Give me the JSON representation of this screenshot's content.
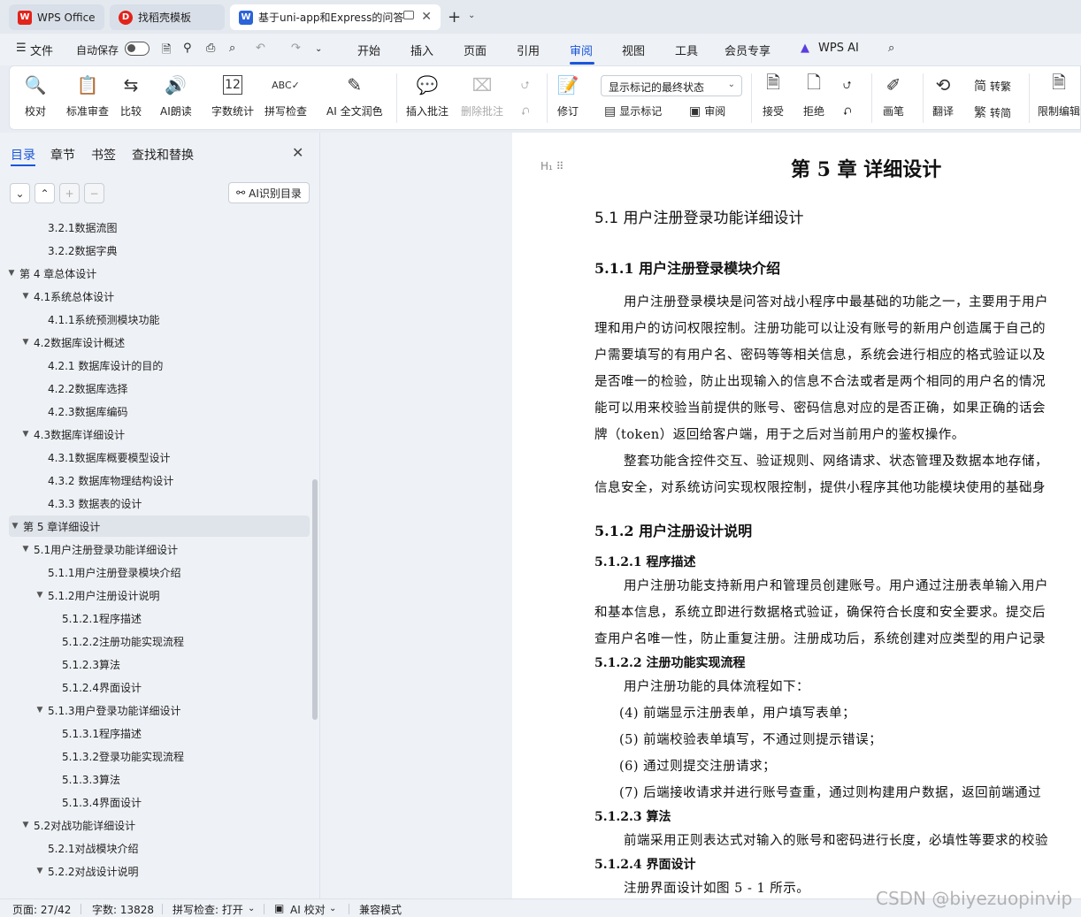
{
  "tabs": [
    {
      "label": "WPS Office",
      "icon": "wps-logo-icon"
    },
    {
      "label": "找稻壳模板",
      "icon": "docer-icon"
    },
    {
      "label": "基于uni-app和Express的问答",
      "icon": "word-doc-icon",
      "active": true
    }
  ],
  "menubar": {
    "file": "文件",
    "autosave": "自动保存",
    "items": [
      "开始",
      "插入",
      "页面",
      "引用",
      "审阅",
      "视图",
      "工具",
      "会员专享",
      "WPS AI"
    ],
    "active": "审阅"
  },
  "ribbon": {
    "proofread": "校对",
    "standard_review": "标准审查",
    "compare": "比较",
    "ai_read": "AI朗读",
    "word_count": "字数统计",
    "spell_check": "拼写检查",
    "ai_proof": "AI 全文润色",
    "insert_comment": "插入批注",
    "delete_comment": "删除批注",
    "track_changes": "修订",
    "display_select": "显示标记的最终状态",
    "show_markup": "显示标记",
    "review_pane": "审阅",
    "accept": "接受",
    "reject": "拒绝",
    "pen": "画笔",
    "translate": "翻译",
    "to_traditional": "转繁",
    "to_simplified": "转简",
    "restrict_edit": "限制编辑"
  },
  "nav": {
    "tabs": [
      "目录",
      "章节",
      "书签",
      "查找和替换"
    ],
    "ai_toc": "AI识别目录",
    "toc": [
      {
        "text": "3.2.1数据流图",
        "level": 3,
        "arrow": ""
      },
      {
        "text": "3.2.2数据字典",
        "level": 3,
        "arrow": ""
      },
      {
        "text": "第 4 章总体设计",
        "level": 1,
        "arrow": "▼"
      },
      {
        "text": "4.1系统总体设计",
        "level": 2,
        "arrow": "▼"
      },
      {
        "text": "4.1.1系统预测模块功能",
        "level": 3,
        "arrow": ""
      },
      {
        "text": "4.2数据库设计概述",
        "level": 2,
        "arrow": "▼"
      },
      {
        "text": "4.2.1  数据库设计的目的",
        "level": 3,
        "arrow": ""
      },
      {
        "text": "4.2.2数据库选择",
        "level": 3,
        "arrow": ""
      },
      {
        "text": "4.2.3数据库编码",
        "level": 3,
        "arrow": ""
      },
      {
        "text": "4.3数据库详细设计",
        "level": 2,
        "arrow": "▼"
      },
      {
        "text": "4.3.1数据库概要模型设计",
        "level": 3,
        "arrow": ""
      },
      {
        "text": "4.3.2  数据库物理结构设计",
        "level": 3,
        "arrow": ""
      },
      {
        "text": "4.3.3     数据表的设计",
        "level": 3,
        "arrow": ""
      },
      {
        "text": "第 5 章详细设计",
        "level": 1,
        "arrow": "▼",
        "selected": true
      },
      {
        "text": "5.1用户注册登录功能详细设计",
        "level": 2,
        "arrow": "▼"
      },
      {
        "text": "5.1.1用户注册登录模块介绍",
        "level": 3,
        "arrow": ""
      },
      {
        "text": "5.1.2用户注册设计说明",
        "level": 3,
        "arrow": "▼"
      },
      {
        "text": "5.1.2.1程序描述",
        "level": 4,
        "arrow": ""
      },
      {
        "text": "5.1.2.2注册功能实现流程",
        "level": 4,
        "arrow": ""
      },
      {
        "text": "5.1.2.3算法",
        "level": 4,
        "arrow": ""
      },
      {
        "text": "5.1.2.4界面设计",
        "level": 4,
        "arrow": ""
      },
      {
        "text": "5.1.3用户登录功能详细设计",
        "level": 3,
        "arrow": "▼"
      },
      {
        "text": "5.1.3.1程序描述",
        "level": 4,
        "arrow": ""
      },
      {
        "text": "5.1.3.2登录功能实现流程",
        "level": 4,
        "arrow": ""
      },
      {
        "text": "5.1.3.3算法",
        "level": 4,
        "arrow": ""
      },
      {
        "text": "5.1.3.4界面设计",
        "level": 4,
        "arrow": ""
      },
      {
        "text": "5.2对战功能详细设计",
        "level": 2,
        "arrow": "▼"
      },
      {
        "text": "5.2.1对战模块介绍",
        "level": 3,
        "arrow": ""
      },
      {
        "text": "5.2.2对战设计说明",
        "level": 3,
        "arrow": "▼"
      }
    ]
  },
  "document": {
    "chapter_title": "第 5 章  详细设计",
    "h2_1": "5.1  用户注册登录功能详细设计",
    "h3_1": "5.1.1  用户注册登录模块介绍",
    "p1": [
      "用户注册登录模块是问答对战小程序中最基础的功能之一，主要用于用户",
      "理和用户的访问权限控制。注册功能可以让没有账号的新用户创造属于自己的",
      "户需要填写的有用户名、密码等等相关信息，系统会进行相应的格式验证以及",
      "是否唯一的检验，防止出现输入的信息不合法或者是两个相同的用户名的情况",
      "能可以用来校验当前提供的账号、密码信息对应的是否正确，如果正确的话会",
      "牌（token）返回给客户端，用于之后对当前用户的鉴权操作。"
    ],
    "p2": [
      "整套功能含控件交互、验证规则、网络请求、状态管理及数据本地存储，",
      "信息安全，对系统访问实现权限控制，提供小程序其他功能模块使用的基础身"
    ],
    "h3_2": "5.1.2  用户注册设计说明",
    "h4_1": "5.1.2.1  程序描述",
    "p3": [
      "用户注册功能支持新用户和管理员创建账号。用户通过注册表单输入用户",
      "和基本信息，系统立即进行数据格式验证，确保符合长度和安全要求。提交后",
      "查用户名唯一性，防止重复注册。注册成功后，系统创建对应类型的用户记录"
    ],
    "h4_2": "5.1.2.2  注册功能实现流程",
    "p4": "用户注册功能的具体流程如下：",
    "steps": [
      "(4)  前端显示注册表单，用户填写表单；",
      "(5)  前端校验表单填写，不通过则提示错误；",
      "(6)  通过则提交注册请求；",
      "(7)  后端接收请求并进行账号查重，通过则构建用户数据，返回前端通过"
    ],
    "h4_3": "5.1.2.3  算法",
    "p5": "前端采用正则表达式对输入的账号和密码进行长度，必填性等要求的校验",
    "h4_4": "5.1.2.4  界面设计",
    "p6": "注册界面设计如图  5 - 1 所示。"
  },
  "status": {
    "page": "页面: 27/42",
    "words": "字数: 13828",
    "spell": "拼写检查: 打开",
    "ai_proof": "AI 校对",
    "compat": "兼容模式"
  },
  "watermark": "CSDN @biyezuopinvip",
  "colors": {
    "accent": "#1a56db",
    "wps_red": "#e2231a",
    "word_blue": "#2b63d9"
  }
}
